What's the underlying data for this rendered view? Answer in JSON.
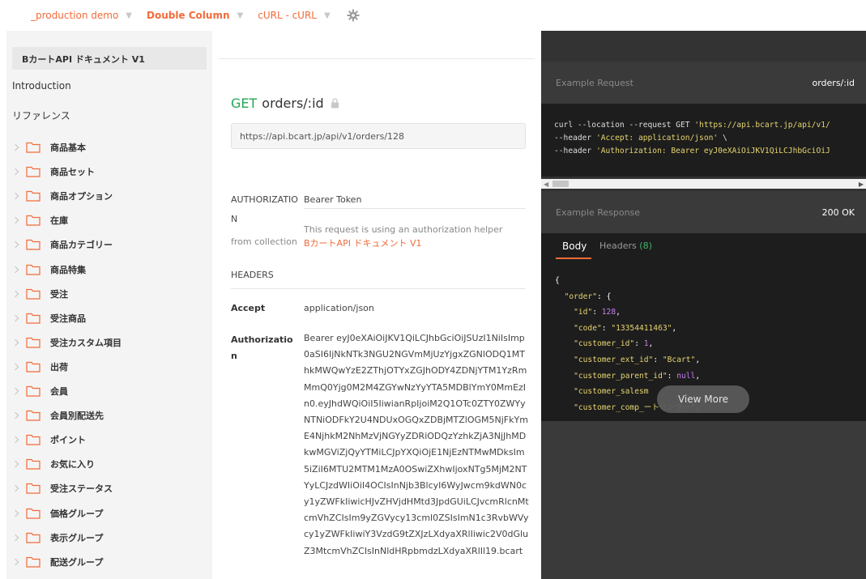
{
  "topbar": {
    "workspace": "_production demo",
    "layout": "Double Column",
    "language": "cURL - cURL"
  },
  "sidebar": {
    "title": "BカートAPI ドキュメント V1",
    "introduction": "Introduction",
    "reference": "リファレンス",
    "folders": [
      "商品基本",
      "商品セット",
      "商品オプション",
      "在庫",
      "商品カテゴリー",
      "商品特集",
      "受注",
      "受注商品",
      "受注カスタム項目",
      "出荷",
      "会員",
      "会員別配送先",
      "ポイント",
      "お気に入り",
      "受注ステータス",
      "価格グループ",
      "表示グループ",
      "配送グループ"
    ]
  },
  "main": {
    "method": "GET",
    "endpoint": "orders/:id",
    "url": "https://api.bcart.jp/api/v1/orders/128",
    "auth_key": "AUTHORIZATION",
    "auth_type": "Bearer Token",
    "auth_note": "This request is using an authorization helper",
    "from_collection": "from collection",
    "collection_name": "BカートAPI ドキュメント V1",
    "headers_label": "HEADERS",
    "headers": [
      {
        "key": "Accept",
        "value": "application/json"
      },
      {
        "key": "Authorization",
        "value": "Bearer eyJ0eXAiOiJKV1QiLCJhbGciOiJSUzI1NiIsImp0aSI6IjNkNTk3NGU2NGVmMjUzYjgxZGNlODQ1MThkMWQwYzE2ZThjOTYxZGJhODY4ZDNjYTM1YzRmMmQ0Yjg0M2M4ZGYwNzYyYTA5MDBlYmY0MmEzIn0.eyJhdWQiOiI5IiwianRpIjoiM2Q1OTc0ZTY0ZWYyNTNiODFkY2U4NDUxOGQxZDBjMTZlOGM5NjFkYmE4NjhkM2NhMzVjNGYyZDRiODQzYzhkZjA3NjJhMDkwMGViZjQyYTMiLCJpYXQiOjE1NjEzNTMwMDksIm5iZiI6MTU2MTM1MzA0OSwiZXhwIjoxNTg5MjM2NTYyLCJzdWIiOiI4OCIsInNjb3BlcyI6WyJwcm9kdWN0cy1yZWFkIiwicHJvZHVjdHMtd3JpdGUiLCJvcmRlcnMtcmVhZCIsIm9yZGVycy13cml0ZSIsImN1c3RvbWVycy1yZWFkIiwiY3VzdG9tZXJzLXdyaXRlIiwic2V0dGluZ3MtcmVhZCIsInNldHRpbmdzLXdyaXRlIl19.bcart"
      }
    ]
  },
  "example_request": {
    "label": "Example Request",
    "title": "orders/:id",
    "code_lines": [
      {
        "plain": "curl --location --request GET ",
        "str": "'https://api.bcart.jp/api/v1/"
      },
      {
        "plain": "--header ",
        "str": "'Accept: application/json'",
        "tail": " \\"
      },
      {
        "plain": "--header ",
        "str": "'Authorization: Bearer eyJ0eXAiOiJKV1QiLCJhbGciOiJ"
      }
    ]
  },
  "example_response": {
    "label": "Example Response",
    "status": "200 OK",
    "tab_body": "Body",
    "tab_headers": "Headers",
    "headers_count": "(8)",
    "view_more": "View More",
    "json_lines": [
      {
        "indent": "",
        "key": "",
        "sep": "",
        "val": "{",
        "type": "plain"
      },
      {
        "indent": "  ",
        "key": "\"order\"",
        "sep": ": ",
        "val": "{",
        "type": "plain"
      },
      {
        "indent": "    ",
        "key": "\"id\"",
        "sep": ": ",
        "val": "128",
        "type": "n",
        "comma": ","
      },
      {
        "indent": "    ",
        "key": "\"code\"",
        "sep": ": ",
        "val": "\"13354411463\"",
        "type": "s",
        "comma": ","
      },
      {
        "indent": "    ",
        "key": "\"customer_id\"",
        "sep": ": ",
        "val": "1",
        "type": "n",
        "comma": ","
      },
      {
        "indent": "    ",
        "key": "\"customer_ext_id\"",
        "sep": ": ",
        "val": "\"Bcart\"",
        "type": "s",
        "comma": ","
      },
      {
        "indent": "    ",
        "key": "\"customer_parent_id\"",
        "sep": ": ",
        "val": "null",
        "type": "n",
        "comma": ","
      },
      {
        "indent": "    ",
        "key": "\"customer_salesm",
        "sep": "",
        "val": "",
        "type": "plain"
      },
      {
        "indent": "    ",
        "key": "\"customer_comp_",
        "sep": "",
        "val": "ートセンター\"",
        "type": "s",
        "comma": ","
      }
    ]
  }
}
